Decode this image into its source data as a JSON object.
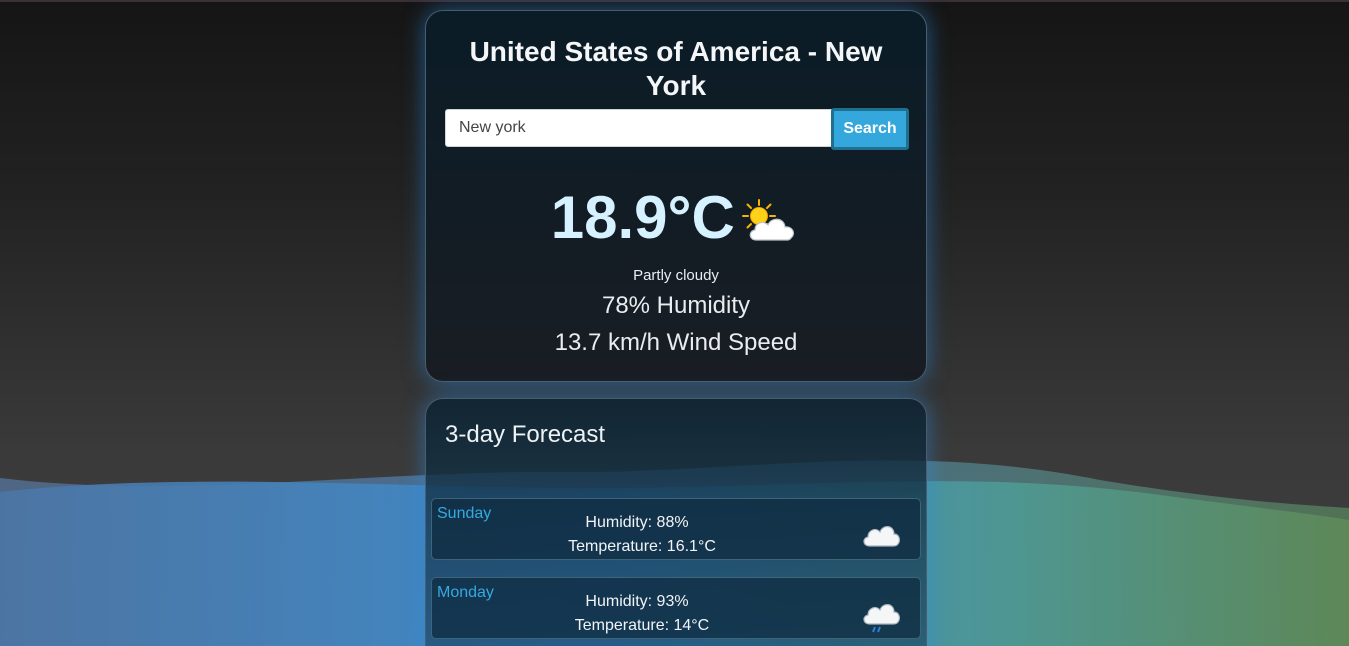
{
  "location": {
    "title": "United States of America - New York"
  },
  "search": {
    "value": "New york",
    "button_label": "Search"
  },
  "current": {
    "temperature": "18.9°C",
    "condition": "Partly cloudy",
    "humidity": "78% Humidity",
    "wind": "13.7 km/h Wind Speed",
    "icon": "partly-cloudy-icon"
  },
  "forecast": {
    "title": "3-day Forecast",
    "days": [
      {
        "day": "Sunday",
        "humidity": "Humidity: 88%",
        "temperature": "Temperature: 16.1°C",
        "icon": "cloud-icon"
      },
      {
        "day": "Monday",
        "humidity": "Humidity: 93%",
        "temperature": "Temperature: 14°C",
        "icon": "rain-cloud-icon"
      }
    ]
  },
  "colors": {
    "accent": "#34a8dc",
    "day_label": "#36a9e0",
    "temperature": "#d6f1ff",
    "glow": "#288ce6"
  }
}
